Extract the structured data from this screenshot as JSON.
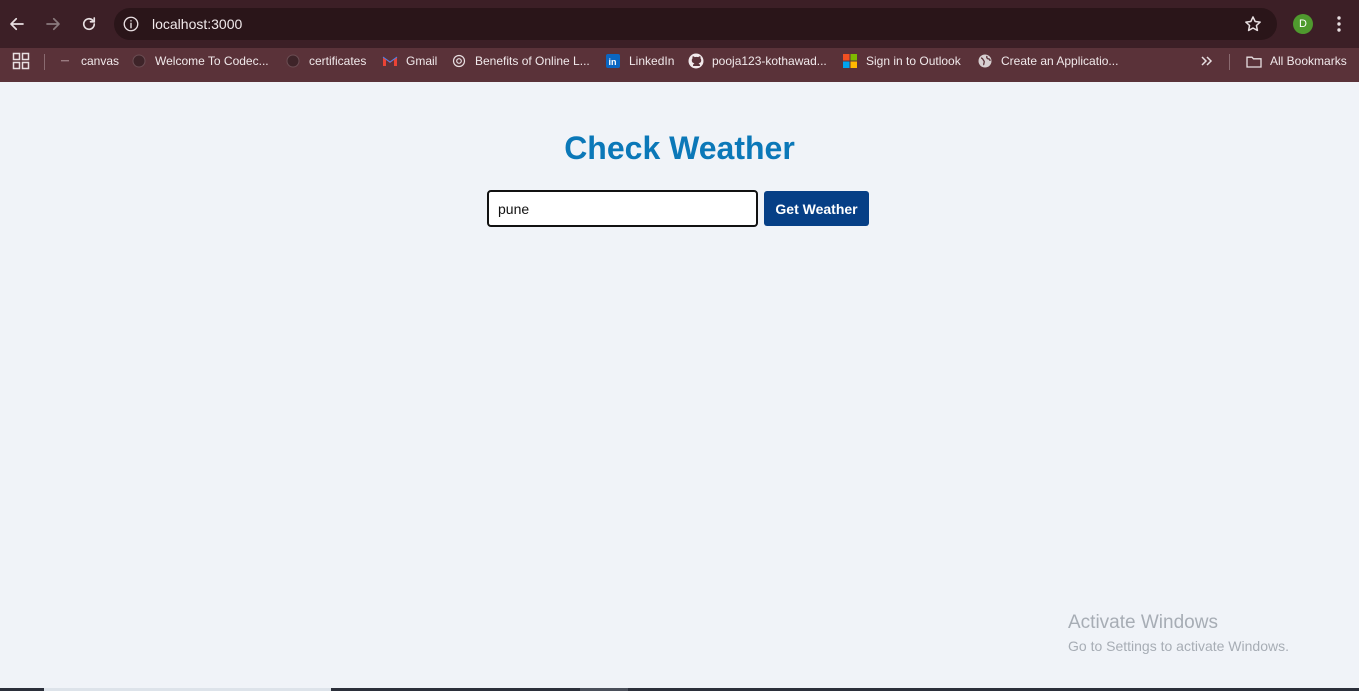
{
  "browser": {
    "url": "localhost:3000",
    "profile_initial": "D",
    "colors": {
      "toolbar": "#3c1f26",
      "bookmarks_bar": "#5a3239",
      "profile": "#4f9a2e"
    }
  },
  "bookmarks": {
    "items": [
      {
        "label": "canvas",
        "icon": "canvas-icon"
      },
      {
        "label": "Welcome To Codec...",
        "icon": "globe-dark-icon"
      },
      {
        "label": "certificates",
        "icon": "globe-dark-icon"
      },
      {
        "label": "Gmail",
        "icon": "gmail-icon"
      },
      {
        "label": "Benefits of Online L...",
        "icon": "openai-icon"
      },
      {
        "label": "LinkedIn",
        "icon": "linkedin-icon"
      },
      {
        "label": "pooja123-kothawad...",
        "icon": "github-icon"
      },
      {
        "label": "Sign in to Outlook",
        "icon": "microsoft-icon"
      },
      {
        "label": "Create an Applicatio...",
        "icon": "globe-icon"
      }
    ],
    "all_bookmarks_label": "All Bookmarks"
  },
  "page": {
    "title": "Check Weather",
    "city_input_value": "pune",
    "button_label": "Get Weather",
    "colors": {
      "background": "#f0f3f8",
      "title": "#0b78b8",
      "button": "#063f86"
    }
  },
  "watermark": {
    "line1": "Activate Windows",
    "line2": "Go to Settings to activate Windows."
  }
}
